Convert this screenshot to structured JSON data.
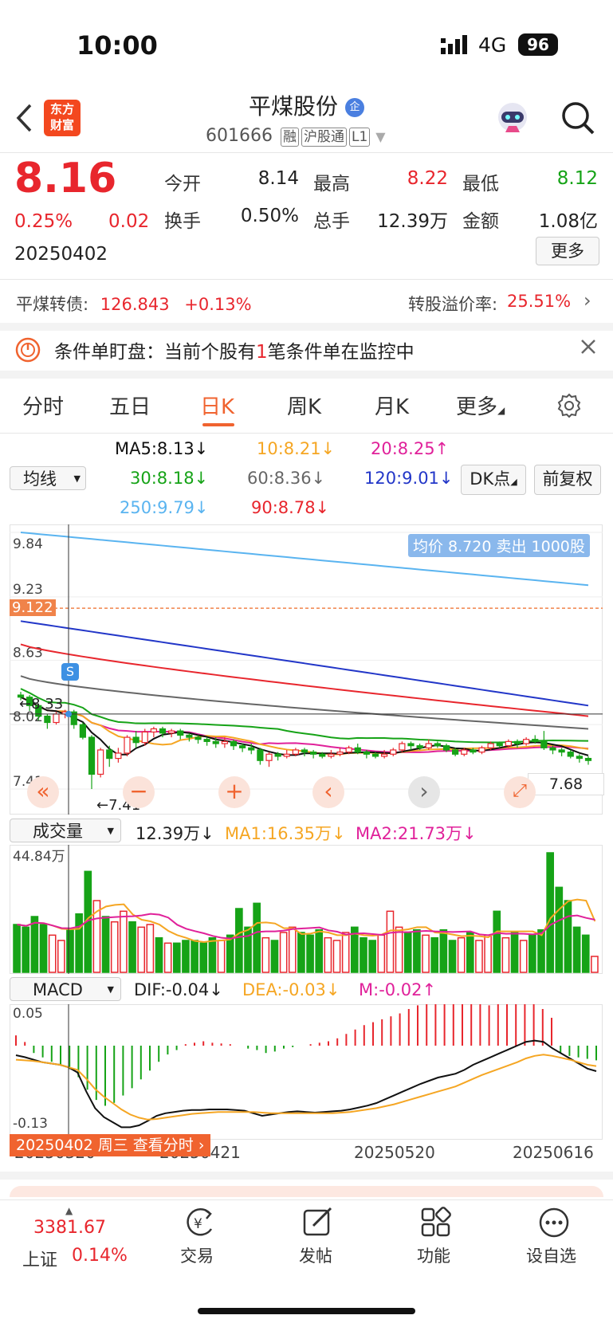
{
  "status": {
    "time": "10:00",
    "network": "4G",
    "battery": "96"
  },
  "header": {
    "logo_text": "东方\n财富",
    "title": "平煤股份",
    "title_badge": "企",
    "code": "601666",
    "tags": [
      "融",
      "沪股通",
      "L1"
    ]
  },
  "quote": {
    "price": "8.16",
    "change_pct": "0.25%",
    "change": "0.02",
    "date": "20250402",
    "fields": [
      {
        "label": "今开",
        "value": "8.14",
        "color": "#222"
      },
      {
        "label": "最高",
        "value": "8.22",
        "color": "#e8262d"
      },
      {
        "label": "最低",
        "value": "8.12",
        "color": "#16a317"
      },
      {
        "label": "换手",
        "value": "0.50%",
        "color": "#222"
      },
      {
        "label": "总手",
        "value": "12.39万",
        "color": "#222"
      },
      {
        "label": "金额",
        "value": "1.08亿",
        "color": "#222"
      }
    ],
    "more_button": "更多"
  },
  "bond": {
    "label": "平煤转债:",
    "price": "126.843",
    "change": "+0.13%",
    "premium_label": "转股溢价率:",
    "premium": "25.51%"
  },
  "alert": {
    "text_prefix": "条件单盯盘：当前个股有",
    "count": "1",
    "text_suffix": "笔条件单在监控中"
  },
  "tabs": [
    "分时",
    "五日",
    "日K",
    "周K",
    "月K",
    "更多"
  ],
  "active_tab": "日K",
  "ma": {
    "selector": "均线",
    "items": [
      {
        "text": "MA5:8.13↓",
        "color": "#111111"
      },
      {
        "text": "10:8.21↓",
        "color": "#f5a623"
      },
      {
        "text": "20:8.25↑",
        "color": "#e0219a"
      },
      {
        "text": "30:8.18↓",
        "color": "#16a317"
      },
      {
        "text": "60:8.36↓",
        "color": "#666666"
      },
      {
        "text": "120:9.01↓",
        "color": "#2236c8"
      },
      {
        "text": "250:9.79↓",
        "color": "#5ab4f0"
      },
      {
        "text": "90:8.78↓",
        "color": "#e8262d"
      }
    ],
    "dk_button": "DK点",
    "fq_button": "前复权"
  },
  "kline": {
    "y_labels": [
      "9.84",
      "9.23",
      "8.63",
      "8.02",
      "7.41"
    ],
    "ref_price": "9.122",
    "avg_note": "均价 8.720 卖出 1000股",
    "high_mark": "←8.33",
    "low_mark": "←7.41",
    "last_label": "7.68",
    "s_marker": "S",
    "candles": [
      [
        8.3,
        8.28,
        8.33,
        8.25
      ],
      [
        8.28,
        8.2,
        8.3,
        8.15
      ],
      [
        8.2,
        8.1,
        8.22,
        8.06
      ],
      [
        8.1,
        8.04,
        8.12,
        7.98
      ],
      [
        8.04,
        8.12,
        8.14,
        8.02
      ],
      [
        8.12,
        8.14,
        8.16,
        8.08
      ],
      [
        8.14,
        8.02,
        8.16,
        7.98
      ],
      [
        8.02,
        7.9,
        8.04,
        7.88
      ],
      [
        7.9,
        7.55,
        7.92,
        7.41
      ],
      [
        7.55,
        7.78,
        7.8,
        7.52
      ],
      [
        7.78,
        7.7,
        7.82,
        7.62
      ],
      [
        7.7,
        7.75,
        7.8,
        7.66
      ],
      [
        7.75,
        7.9,
        7.92,
        7.72
      ],
      [
        7.9,
        7.85,
        7.96,
        7.8
      ],
      [
        7.85,
        7.95,
        7.98,
        7.82
      ],
      [
        7.95,
        7.98,
        8.0,
        7.9
      ],
      [
        7.98,
        7.94,
        8.0,
        7.9
      ],
      [
        7.94,
        7.96,
        7.98,
        7.9
      ],
      [
        7.96,
        7.92,
        7.98,
        7.88
      ],
      [
        7.92,
        7.9,
        7.94,
        7.86
      ],
      [
        7.9,
        7.88,
        7.92,
        7.84
      ],
      [
        7.88,
        7.86,
        7.9,
        7.82
      ],
      [
        7.86,
        7.84,
        7.9,
        7.8
      ],
      [
        7.84,
        7.86,
        7.9,
        7.8
      ],
      [
        7.86,
        7.82,
        7.88,
        7.78
      ],
      [
        7.82,
        7.8,
        7.84,
        7.76
      ],
      [
        7.8,
        7.78,
        7.84,
        7.74
      ],
      [
        7.78,
        7.68,
        7.8,
        7.64
      ],
      [
        7.68,
        7.74,
        7.76,
        7.62
      ],
      [
        7.74,
        7.72,
        7.76,
        7.68
      ],
      [
        7.72,
        7.74,
        7.78,
        7.7
      ],
      [
        7.74,
        7.78,
        7.8,
        7.72
      ],
      [
        7.78,
        7.76,
        7.8,
        7.72
      ],
      [
        7.76,
        7.74,
        7.78,
        7.7
      ],
      [
        7.74,
        7.72,
        7.76,
        7.7
      ],
      [
        7.72,
        7.74,
        7.78,
        7.7
      ],
      [
        7.74,
        7.76,
        7.8,
        7.72
      ],
      [
        7.76,
        7.8,
        7.82,
        7.74
      ],
      [
        7.8,
        7.76,
        7.84,
        7.74
      ],
      [
        7.76,
        7.74,
        7.78,
        7.7
      ],
      [
        7.74,
        7.72,
        7.76,
        7.7
      ],
      [
        7.72,
        7.74,
        7.78,
        7.7
      ],
      [
        7.74,
        7.78,
        7.8,
        7.72
      ],
      [
        7.78,
        7.84,
        7.86,
        7.76
      ],
      [
        7.84,
        7.82,
        7.86,
        7.78
      ],
      [
        7.82,
        7.8,
        7.84,
        7.78
      ],
      [
        7.8,
        7.84,
        7.88,
        7.78
      ],
      [
        7.84,
        7.82,
        7.86,
        7.8
      ],
      [
        7.82,
        7.78,
        7.84,
        7.76
      ],
      [
        7.78,
        7.74,
        7.8,
        7.72
      ],
      [
        7.74,
        7.78,
        7.8,
        7.72
      ],
      [
        7.78,
        7.76,
        7.8,
        7.74
      ],
      [
        7.76,
        7.8,
        7.82,
        7.74
      ],
      [
        7.8,
        7.84,
        7.86,
        7.78
      ],
      [
        7.84,
        7.82,
        7.86,
        7.8
      ],
      [
        7.82,
        7.86,
        7.88,
        7.8
      ],
      [
        7.86,
        7.84,
        7.88,
        7.8
      ],
      [
        7.84,
        7.88,
        7.9,
        7.82
      ],
      [
        7.88,
        7.86,
        7.92,
        7.84
      ],
      [
        7.86,
        7.8,
        7.96,
        7.78
      ],
      [
        7.8,
        7.78,
        7.82,
        7.74
      ],
      [
        7.78,
        7.76,
        7.8,
        7.72
      ],
      [
        7.76,
        7.72,
        7.78,
        7.7
      ],
      [
        7.72,
        7.7,
        7.74,
        7.66
      ],
      [
        7.7,
        7.68,
        7.72,
        7.64
      ]
    ]
  },
  "volume": {
    "selector": "成交量",
    "value": "12.39万↓",
    "ma1": "MA1:16.35万↓",
    "ma2": "MA2:21.73万↓",
    "ymax": "44.84万",
    "bars": [
      18,
      17,
      21,
      18,
      14,
      12,
      16,
      22,
      38,
      27,
      21,
      19,
      23,
      19,
      17,
      18,
      13,
      11,
      11,
      12,
      12,
      11,
      13,
      12,
      14,
      24,
      17,
      26,
      13,
      12,
      15,
      17,
      15,
      14,
      16,
      13,
      12,
      15,
      17,
      13,
      12,
      14,
      23,
      17,
      15,
      16,
      14,
      13,
      16,
      12,
      13,
      15,
      12,
      14,
      23,
      13,
      15,
      12,
      14,
      16,
      45,
      32,
      27,
      17,
      14,
      6
    ]
  },
  "macd": {
    "selector": "MACD",
    "dif": "DIF:-0.04↓",
    "dea": "DEA:-0.03↓",
    "m": "M:-0.02↑",
    "ymax": "0.05",
    "ymin": "-0.13",
    "x_labels": [
      "20250320",
      "20250421",
      "20250520",
      "20250616"
    ],
    "cursor_label": "20250402 周三 查看分时",
    "hist": [
      0.014,
      0.005,
      -0.01,
      -0.016,
      -0.022,
      -0.026,
      -0.032,
      -0.043,
      -0.06,
      -0.074,
      -0.082,
      -0.078,
      -0.068,
      -0.058,
      -0.046,
      -0.034,
      -0.022,
      -0.012,
      -0.006,
      0.002,
      0.004,
      0.006,
      0.004,
      0.003,
      0.002,
      0.0,
      -0.004,
      -0.006,
      -0.01,
      -0.008,
      -0.004,
      -0.002,
      0.0,
      0.002,
      0.004,
      0.006,
      0.01,
      0.016,
      0.022,
      0.028,
      0.032,
      0.036,
      0.04,
      0.044,
      0.05,
      0.055,
      0.062,
      0.065,
      0.068,
      0.072,
      0.068,
      0.062,
      0.058,
      0.055,
      0.06,
      0.066,
      0.07,
      0.068,
      0.062,
      0.05,
      0.038,
      -0.01,
      -0.014,
      -0.016,
      -0.018,
      -0.02
    ],
    "dif_line": [
      -0.015,
      -0.018,
      -0.022,
      -0.026,
      -0.028,
      -0.03,
      -0.034,
      -0.042,
      -0.072,
      -0.098,
      -0.112,
      -0.12,
      -0.128,
      -0.128,
      -0.125,
      -0.118,
      -0.11,
      -0.106,
      -0.104,
      -0.102,
      -0.101,
      -0.101,
      -0.1,
      -0.1,
      -0.1,
      -0.101,
      -0.102,
      -0.106,
      -0.11,
      -0.108,
      -0.106,
      -0.104,
      -0.103,
      -0.104,
      -0.105,
      -0.104,
      -0.103,
      -0.102,
      -0.1,
      -0.097,
      -0.094,
      -0.09,
      -0.084,
      -0.078,
      -0.072,
      -0.066,
      -0.06,
      -0.055,
      -0.05,
      -0.047,
      -0.044,
      -0.038,
      -0.03,
      -0.024,
      -0.018,
      -0.012,
      -0.006,
      0.0,
      0.006,
      0.008,
      0.006,
      -0.004,
      -0.012,
      -0.02,
      -0.028,
      -0.036,
      -0.04
    ],
    "dea_line": [
      -0.022,
      -0.023,
      -0.024,
      -0.026,
      -0.028,
      -0.03,
      -0.034,
      -0.038,
      -0.052,
      -0.068,
      -0.08,
      -0.09,
      -0.1,
      -0.108,
      -0.113,
      -0.116,
      -0.115,
      -0.113,
      -0.111,
      -0.109,
      -0.107,
      -0.106,
      -0.105,
      -0.104,
      -0.104,
      -0.104,
      -0.104,
      -0.104,
      -0.105,
      -0.106,
      -0.106,
      -0.106,
      -0.106,
      -0.106,
      -0.106,
      -0.106,
      -0.106,
      -0.105,
      -0.104,
      -0.102,
      -0.1,
      -0.098,
      -0.095,
      -0.092,
      -0.088,
      -0.084,
      -0.08,
      -0.076,
      -0.072,
      -0.068,
      -0.064,
      -0.058,
      -0.052,
      -0.046,
      -0.041,
      -0.036,
      -0.031,
      -0.026,
      -0.02,
      -0.016,
      -0.014,
      -0.016,
      -0.019,
      -0.022,
      -0.026,
      -0.03,
      -0.032
    ]
  },
  "bottom": {
    "index_value": "3381.67",
    "index_name": "上证",
    "index_change": "0.14%",
    "items": [
      "交易",
      "发帖",
      "功能",
      "设自选"
    ]
  }
}
